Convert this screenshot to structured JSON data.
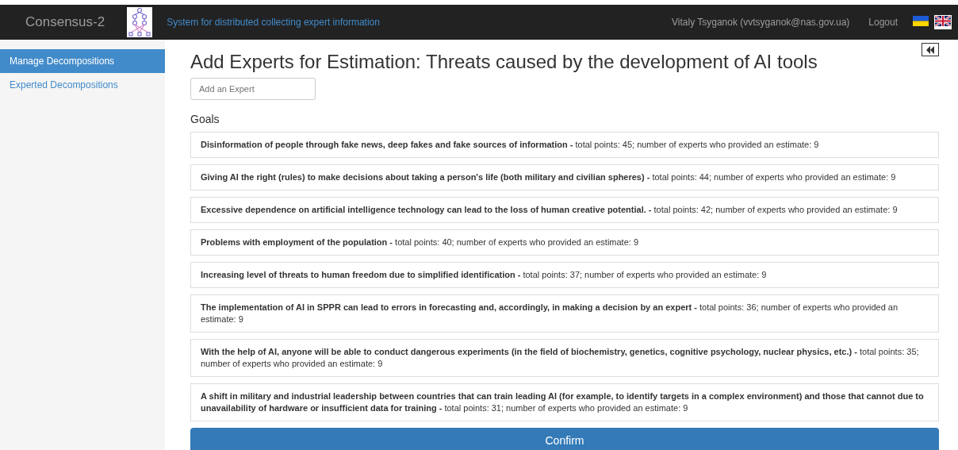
{
  "navbar": {
    "brand": "Consensus-2",
    "tagline": "System for distributed collecting expert information",
    "user": "Vitaly Tsyganok (vvtsyganok@nas.gov.ua)",
    "logout": "Logout",
    "languages": [
      {
        "kind": "ua",
        "selected": false
      },
      {
        "kind": "uk",
        "selected": true
      }
    ]
  },
  "sidebar": {
    "items": [
      {
        "label": "Manage Decompositions",
        "selected": true
      },
      {
        "label": "Experted Decompositions",
        "selected": false
      }
    ]
  },
  "page": {
    "title": "Add Experts for Estimation: Threats caused by the development of AI tools",
    "expert_field": {
      "placeholder": "Add an Expert"
    },
    "goals_heading": "Goals",
    "goals": [
      {
        "text": "**Disinformation of people through fake news, deep fakes and fake sources of information -** total points: 45; number of experts who provided an estimate: 9"
      },
      {
        "text": "**Giving AI the right (rules) to make decisions about taking a person's life (both military and civilian spheres) -** total points: 44; number of experts who provided an estimate: 9"
      },
      {
        "text": "**Excessive dependence on artificial intelligence technology can lead to the loss of human creative potential. -** total points: 42; number of experts who provided an estimate: 9"
      },
      {
        "text": "**Problems with employment of the population -** total points: 40; number of experts who provided an estimate: 9"
      },
      {
        "text": "**Increasing level of threats to human freedom due to simplified identification -** total points: 37; number of experts who provided an estimate: 9"
      },
      {
        "text": "**The implementation of AI in SPPR can lead to errors in forecasting and, accordingly, in making a decision by an expert -** total points: 36; number of experts who provided an estimate: 9"
      },
      {
        "text": "**With the help of AI, anyone will be able to conduct dangerous experiments (in the field of biochemistry, genetics, cognitive psychology, nuclear physics, etc.) -** total points: 35; number of experts who provided an estimate: 9"
      },
      {
        "text": "**A shift in military and industrial leadership between countries that can train leading AI (for example, to identify targets in a complex environment) and those that cannot due to unavailability of hardware or insufficient data for training -** total points: 31; number of experts who provided an estimate: 9"
      }
    ],
    "confirm": "Confirm"
  }
}
